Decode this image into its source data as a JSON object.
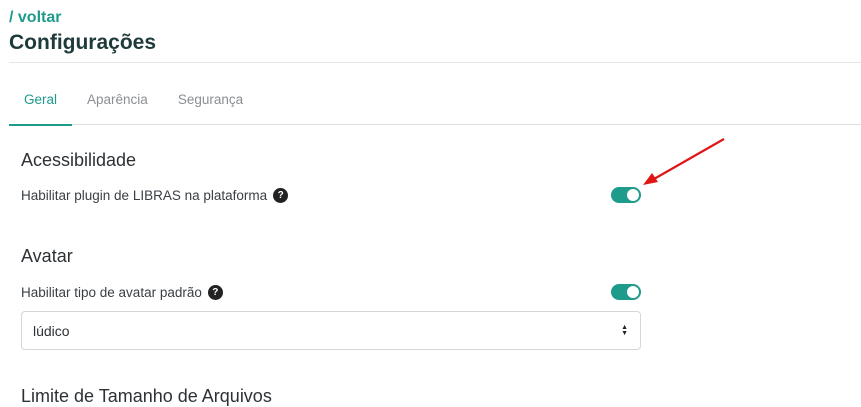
{
  "header": {
    "back_link": "/ voltar",
    "title": "Configurações"
  },
  "tabs": [
    {
      "label": "Geral",
      "active": true
    },
    {
      "label": "Aparência",
      "active": false
    },
    {
      "label": "Segurança",
      "active": false
    }
  ],
  "sections": {
    "accessibility": {
      "title": "Acessibilidade",
      "libras_label": "Habilitar plugin de LIBRAS na plataforma",
      "libras_enabled": true
    },
    "avatar": {
      "title": "Avatar",
      "default_avatar_label": "Habilitar tipo de avatar padrão",
      "default_avatar_enabled": true,
      "avatar_type_value": "lúdico"
    },
    "file_size": {
      "title": "Limite de Tamanho de Arquivos"
    }
  },
  "colors": {
    "accent": "#1e9b8a",
    "annotation_arrow": "#e01515"
  },
  "icons": {
    "help": "question-circle-icon",
    "select": "sort-arrows-icon"
  }
}
